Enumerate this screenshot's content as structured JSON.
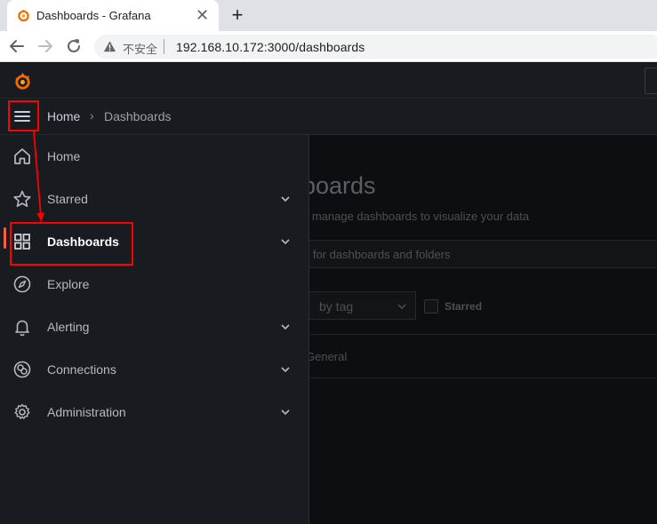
{
  "browser": {
    "tab_title": "Dashboards - Grafana",
    "tab_close": "✕",
    "new_tab": "+",
    "security_text": "不安全",
    "url": "192.168.10.172:3000/dashboards"
  },
  "breadcrumb": {
    "home": "Home",
    "separator": "›",
    "current": "Dashboards"
  },
  "nav_menu": {
    "items": [
      {
        "label": "Home",
        "icon": "home-icon",
        "expandable": false,
        "active": false
      },
      {
        "label": "Starred",
        "icon": "star-icon",
        "expandable": true,
        "active": false
      },
      {
        "label": "Dashboards",
        "icon": "apps-icon",
        "expandable": true,
        "active": true
      },
      {
        "label": "Explore",
        "icon": "compass-icon",
        "expandable": false,
        "active": false
      },
      {
        "label": "Alerting",
        "icon": "bell-icon",
        "expandable": true,
        "active": false
      },
      {
        "label": "Connections",
        "icon": "connections-icon",
        "expandable": true,
        "active": false
      },
      {
        "label": "Administration",
        "icon": "cog-icon",
        "expandable": true,
        "active": false
      }
    ]
  },
  "main": {
    "title": "boards",
    "subtitle": "d manage dashboards to visualize your data",
    "search_placeholder": "h for dashboards and folders",
    "tag_filter": "by tag",
    "starred_label": "Starred",
    "folder": "General"
  },
  "colors": {
    "accent": "#f55f3e",
    "annotation": "#ff0000",
    "sidebar_bg": "#181b1f"
  }
}
